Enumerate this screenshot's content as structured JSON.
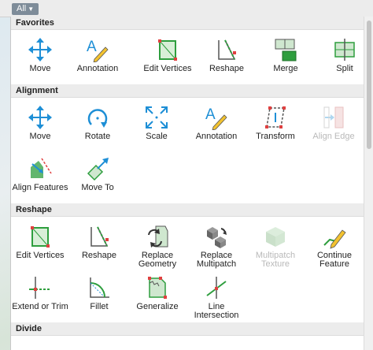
{
  "filter": {
    "label": "All"
  },
  "sections": [
    {
      "id": "favorites",
      "title": "Favorites"
    },
    {
      "id": "alignment",
      "title": "Alignment"
    },
    {
      "id": "reshape",
      "title": "Reshape"
    },
    {
      "id": "divide",
      "title": "Divide"
    }
  ],
  "tools": {
    "favorites": [
      "Move",
      "Annotation",
      "Edit Vertices",
      "Reshape",
      "Merge",
      "Split"
    ],
    "alignment": [
      "Move",
      "Rotate",
      "Scale",
      "Annotation",
      "Transform",
      "Align Edge",
      "Align Features",
      "Move To"
    ],
    "reshape": [
      "Edit Vertices",
      "Reshape",
      "Replace Geometry",
      "Replace Multipatch",
      "Multipatch Texture",
      "Continue Feature",
      "Extend or Trim",
      "Fillet",
      "Generalize",
      "Line Intersection"
    ]
  },
  "disabled_tools": [
    "Align Edge",
    "Multipatch Texture"
  ],
  "colors": {
    "accent_blue": "#1e8fd6",
    "edit_green": "#2e9e3e",
    "vertex_red": "#e04040",
    "pencil_yellow": "#f2c230"
  }
}
